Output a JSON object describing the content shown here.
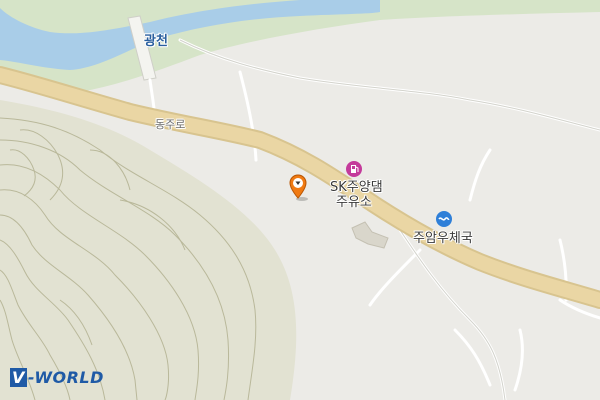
{
  "map": {
    "colors": {
      "background": "#ecebe7",
      "river": "#a9cde8",
      "riverbank": "#d6e4c8",
      "road_main": "#ead6a4",
      "road_minor": "#ffffff",
      "hill": "#e2e2d2",
      "contour": "#b9b89a",
      "marker": "#f07a12"
    },
    "labels": {
      "river": "광천",
      "road": "동주로",
      "gas_station_line1": "SK주양댐",
      "gas_station_line2": "주유소",
      "post_office": "주암우체국"
    },
    "icons": {
      "gas_station": "gas-station-icon",
      "post_office": "post-office-icon",
      "marker": "location-marker-icon"
    },
    "logo": {
      "prefix": "V",
      "text": "-WORLD"
    }
  }
}
